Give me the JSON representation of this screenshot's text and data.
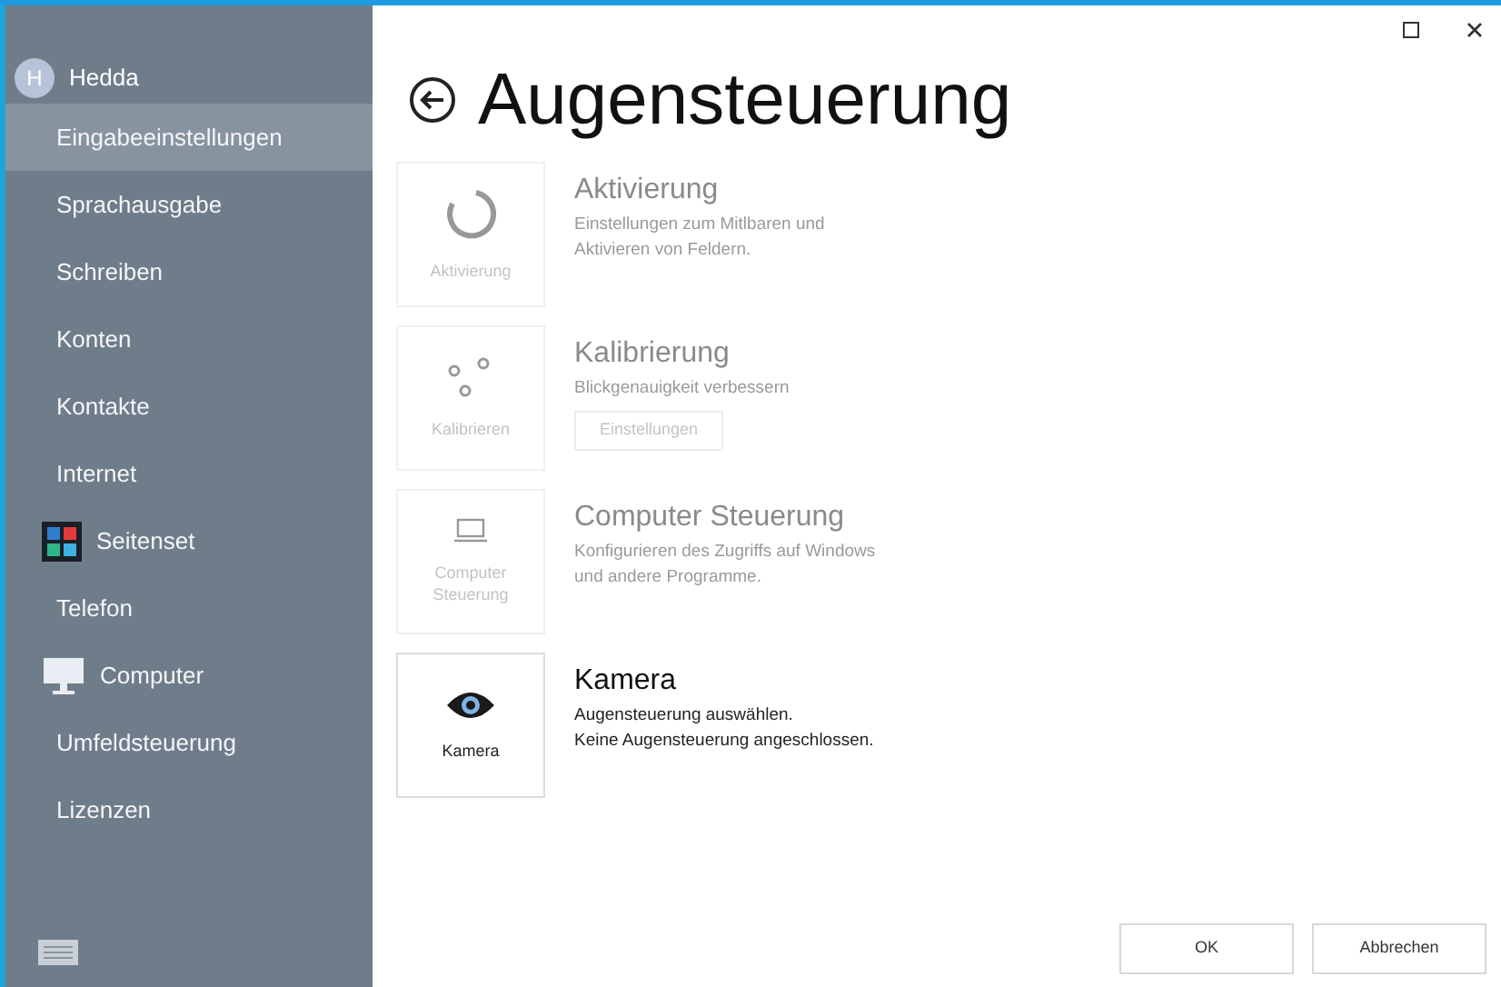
{
  "profile": {
    "initial": "H",
    "name": "Hedda"
  },
  "sidebar": {
    "items": [
      {
        "label": "Eingabeeinstellungen",
        "kind": "plain",
        "selected": true
      },
      {
        "label": "Sprachausgabe",
        "kind": "plain",
        "selected": false
      },
      {
        "label": "Schreiben",
        "kind": "plain",
        "selected": false
      },
      {
        "label": "Konten",
        "kind": "plain",
        "selected": false
      },
      {
        "label": "Kontakte",
        "kind": "plain",
        "selected": false
      },
      {
        "label": "Internet",
        "kind": "plain",
        "selected": false
      },
      {
        "label": "Seitenset",
        "kind": "tiles",
        "selected": false
      },
      {
        "label": "Telefon",
        "kind": "plain",
        "selected": false
      },
      {
        "label": "Computer",
        "kind": "monitor",
        "selected": false
      },
      {
        "label": "Umfeldsteuerung",
        "kind": "plain",
        "selected": false
      },
      {
        "label": "Lizenzen",
        "kind": "plain",
        "selected": false
      }
    ]
  },
  "page": {
    "title": "Augensteuerung"
  },
  "sections": [
    {
      "kind": "spinner",
      "tile_label": "Aktivierung",
      "title": "Aktivierung",
      "description": [
        "Einstellungen zum Mitlbaren und",
        "Aktivieren von Feldern."
      ],
      "disabled": true
    },
    {
      "kind": "dots",
      "tile_label": "Kalibrieren",
      "title": "Kalibrierung",
      "description": [
        "Blickgenauigkeit verbessern"
      ],
      "button": "Einstellungen",
      "disabled": true
    },
    {
      "kind": "laptop",
      "tile_label": "Computer Steuerung",
      "title": "Computer Steuerung",
      "description": [
        "Konfigurieren des Zugriffs auf Windows",
        "und andere Programme."
      ],
      "disabled": true
    },
    {
      "kind": "eye",
      "tile_label": "Kamera",
      "title": "Kamera",
      "description": [
        "Augensteuerung auswählen.",
        "Keine Augensteuerung angeschlossen."
      ],
      "disabled": false
    }
  ],
  "buttons": [
    "OK",
    "Abbrechen"
  ]
}
